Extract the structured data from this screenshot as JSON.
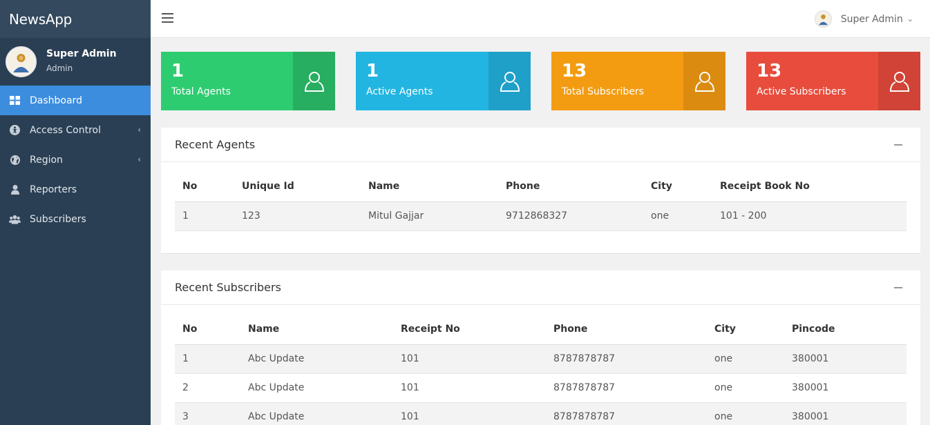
{
  "brand": {
    "title": "NewsApp"
  },
  "profile": {
    "name": "Super Admin",
    "role": "Admin"
  },
  "sidebar": {
    "items": [
      {
        "label": "Dashboard",
        "icon": "dashboard-icon",
        "active": true
      },
      {
        "label": "Access Control",
        "icon": "universal-access-icon"
      },
      {
        "label": "Region",
        "icon": "globe-icon"
      },
      {
        "label": "Reporters",
        "icon": "user-icon"
      },
      {
        "label": "Subscribers",
        "icon": "users-icon"
      }
    ]
  },
  "topbar": {
    "user_name": "Super Admin"
  },
  "tiles": [
    {
      "value": "1",
      "label": "Total Agents",
      "color": "#2ecc71",
      "icon_bg": "#27ae60"
    },
    {
      "value": "1",
      "label": "Active Agents",
      "color": "#22b5e1",
      "icon_bg": "#1fa0c9"
    },
    {
      "value": "13",
      "label": "Total Subscribers",
      "color": "#f39c12",
      "icon_bg": "#db8c10"
    },
    {
      "value": "13",
      "label": "Active Subscribers",
      "color": "#e74c3c",
      "icon_bg": "#d04336"
    }
  ],
  "recent_agents": {
    "title": "Recent Agents",
    "columns": [
      "No",
      "Unique Id",
      "Name",
      "Phone",
      "City",
      "Receipt Book No"
    ],
    "rows": [
      [
        "1",
        "123",
        "Mitul Gajjar",
        "9712868327",
        "one",
        "101 - 200"
      ]
    ]
  },
  "recent_subscribers": {
    "title": "Recent Subscribers",
    "columns": [
      "No",
      "Name",
      "Receipt No",
      "Phone",
      "City",
      "Pincode"
    ],
    "rows": [
      [
        "1",
        "Abc Update",
        "101",
        "8787878787",
        "one",
        "380001"
      ],
      [
        "2",
        "Abc Update",
        "101",
        "8787878787",
        "one",
        "380001"
      ],
      [
        "3",
        "Abc Update",
        "101",
        "8787878787",
        "one",
        "380001"
      ]
    ]
  }
}
